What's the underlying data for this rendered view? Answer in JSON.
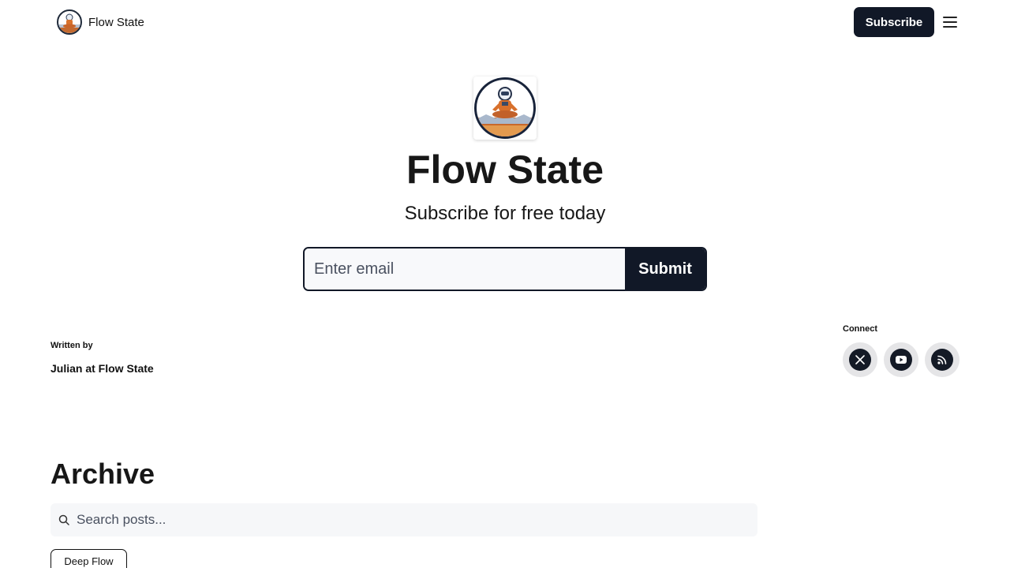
{
  "nav": {
    "brand_name": "Flow State",
    "subscribe_label": "Subscribe",
    "menu_icon": "hamburger-menu-icon"
  },
  "hero": {
    "logo_icon": "meditating-astronaut-logo",
    "title": "Flow State",
    "subtitle": "Subscribe for free today",
    "email_placeholder": "Enter email",
    "submit_label": "Submit"
  },
  "author": {
    "label": "Written by",
    "name": "Julian at Flow State"
  },
  "connect": {
    "label": "Connect",
    "links": [
      {
        "icon": "x-twitter-icon"
      },
      {
        "icon": "youtube-icon"
      },
      {
        "icon": "rss-icon"
      }
    ]
  },
  "archive": {
    "title": "Archive",
    "search_placeholder": "Search posts...",
    "tags": [
      "Deep Flow"
    ]
  },
  "colors": {
    "primary": "#111827",
    "text": "#171717",
    "input_bg": "#f8f9fb",
    "social_bg": "#e5e5e7"
  }
}
